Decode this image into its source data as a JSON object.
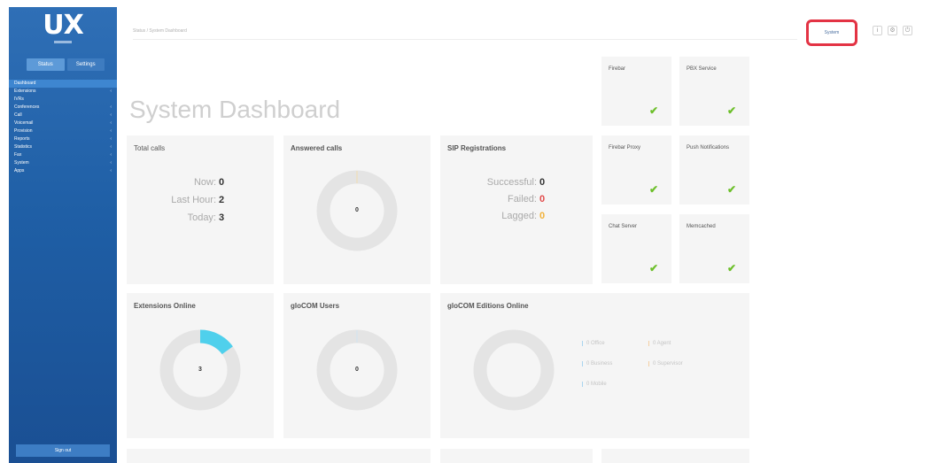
{
  "sidebar": {
    "logo": "UX",
    "tabs": [
      {
        "label": "Status"
      },
      {
        "label": "Settings"
      }
    ],
    "items": [
      {
        "label": "Dashboard",
        "active": true,
        "arrow": false
      },
      {
        "label": "Extensions",
        "active": false,
        "arrow": true
      },
      {
        "label": "IVRs",
        "active": false,
        "arrow": false
      },
      {
        "label": "Conferences",
        "active": false,
        "arrow": true
      },
      {
        "label": "Call",
        "active": false,
        "arrow": true
      },
      {
        "label": "Voicemail",
        "active": false,
        "arrow": true
      },
      {
        "label": "Provision",
        "active": false,
        "arrow": true
      },
      {
        "label": "Reports",
        "active": false,
        "arrow": true
      },
      {
        "label": "Statistics",
        "active": false,
        "arrow": true
      },
      {
        "label": "Fax",
        "active": false,
        "arrow": true
      },
      {
        "label": "System",
        "active": false,
        "arrow": true
      },
      {
        "label": "Apps",
        "active": false,
        "arrow": true
      }
    ],
    "footer": "Sign out"
  },
  "topbar": {
    "breadcrumb": "Status / System Dashboard",
    "system_button": "System",
    "icons": [
      "info-icon",
      "settings-icon",
      "power-icon"
    ]
  },
  "page_title": "System Dashboard",
  "total_calls": {
    "title": "Total calls",
    "rows": [
      {
        "label": "Now:",
        "value": "0"
      },
      {
        "label": "Last Hour:",
        "value": "2"
      },
      {
        "label": "Today:",
        "value": "3"
      }
    ]
  },
  "answered_calls": {
    "title": "Answered calls",
    "center": "0",
    "fraction": 0
  },
  "sip_registrations": {
    "title": "SIP Registrations",
    "rows": [
      {
        "label": "Successful:",
        "value": "0",
        "color": "#333333"
      },
      {
        "label": "Failed:",
        "value": "0",
        "color": "#e24a4a"
      },
      {
        "label": "Lagged:",
        "value": "0",
        "color": "#f2b23a"
      }
    ]
  },
  "services": [
    {
      "name": "Firebar",
      "status": "ok"
    },
    {
      "name": "PBX Service",
      "status": "ok"
    },
    {
      "name": "Firebar Proxy",
      "status": "ok"
    },
    {
      "name": "Push Notifications",
      "status": "ok"
    },
    {
      "name": "Chat Server",
      "status": "ok"
    },
    {
      "name": "Memcached",
      "status": "ok"
    }
  ],
  "extensions_online": {
    "title": "Extensions Online",
    "center": "3",
    "fraction": 0.15,
    "accent": "#4fd0ec"
  },
  "glocom_users": {
    "title": "gloCOM Users",
    "center": "0",
    "fraction": 0
  },
  "glocom_editions": {
    "title": "gloCOM Editions Online",
    "legend": [
      {
        "label": "0 Office",
        "color": "#a9d4ef"
      },
      {
        "label": "0 Agent",
        "color": "#f4cfa3"
      },
      {
        "label": "0 Business",
        "color": "#a9d4ef"
      },
      {
        "label": "0 Supervisor",
        "color": "#f4cfa3"
      },
      {
        "label": "0 Mobile",
        "color": "#a9d4ef"
      }
    ]
  },
  "colors": {
    "sidebar": "#1f5fa6",
    "accent_highlight": "#e33344",
    "ok_check": "#6cbf2a",
    "card_bg": "#f5f5f5"
  }
}
